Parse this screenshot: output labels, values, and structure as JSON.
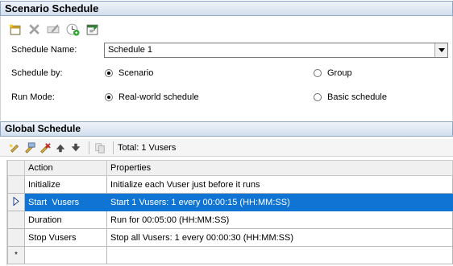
{
  "scenario_schedule": {
    "title": "Scenario Schedule",
    "toolbar": [
      {
        "icon": "new-schedule-icon"
      },
      {
        "icon": "delete-icon"
      },
      {
        "icon": "rename-icon"
      },
      {
        "icon": "run-time-settings-icon"
      },
      {
        "icon": "schedule-settings-icon"
      }
    ],
    "schedule_name_label": "Schedule Name:",
    "schedule_name_value": "Schedule 1",
    "schedule_by_label": "Schedule by:",
    "schedule_by_options": [
      {
        "label": "Scenario",
        "checked": true
      },
      {
        "label": "Group",
        "checked": false
      }
    ],
    "run_mode_label": "Run Mode:",
    "run_mode_options": [
      {
        "label": "Real-world schedule",
        "checked": true
      },
      {
        "label": "Basic schedule",
        "checked": false
      }
    ]
  },
  "global_schedule": {
    "title": "Global Schedule",
    "toolbar": [
      {
        "icon": "add-action-icon"
      },
      {
        "icon": "edit-action-icon"
      },
      {
        "icon": "delete-action-icon"
      },
      {
        "icon": "move-up-icon"
      },
      {
        "icon": "move-down-icon"
      },
      {
        "icon": "copy-icon"
      }
    ],
    "total_text": "Total: 1 Vusers",
    "columns": [
      "Action",
      "Properties"
    ],
    "rows": [
      {
        "action": "Initialize",
        "properties": "Initialize each Vuser just before it runs",
        "selected": false
      },
      {
        "action": "Start  Vusers",
        "properties": "Start 1 Vusers: 1 every 00:00:15 (HH:MM:SS)",
        "selected": true
      },
      {
        "action": "Duration",
        "properties": "Run for 00:05:00 (HH:MM:SS)",
        "selected": false
      },
      {
        "action": "Stop Vusers",
        "properties": "Stop all Vusers: 1 every 00:00:30 (HH:MM:SS)",
        "selected": false
      }
    ],
    "new_row_marker": "*"
  },
  "colors": {
    "selection": "#0f74d3",
    "header_border": "#8ea6c4"
  }
}
